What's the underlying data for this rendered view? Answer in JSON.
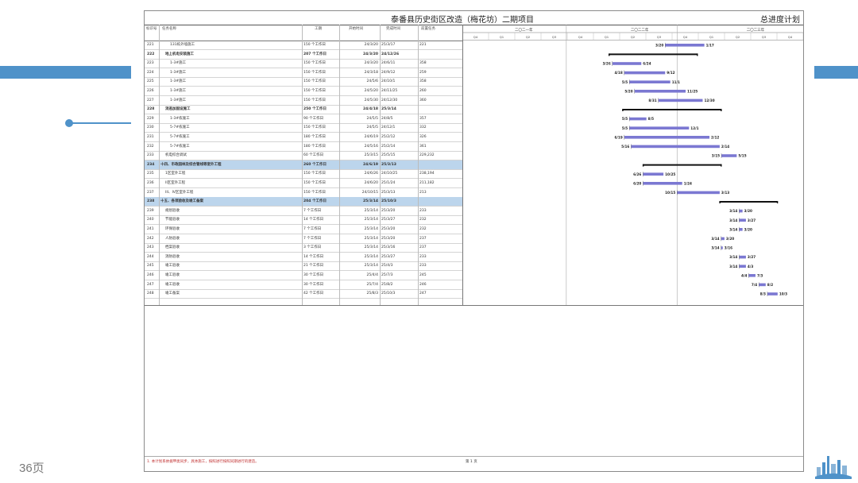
{
  "page_number": "36页",
  "colors": {
    "accent": "#4f92c9",
    "summary_row": "#bcd5ec",
    "task_bar": "#7b78d2",
    "summary_bar": "#111111",
    "note_text": "#c03030"
  },
  "sheet": {
    "title": "泰番县历史街区改造（梅花坊）二期项目",
    "plan_label": "总进度计划",
    "columns": [
      "标识号",
      "任务名称",
      "工期",
      "开始时间",
      "完成时间",
      "前置任务"
    ],
    "timeline_labels": [
      "二〇二一年",
      "二〇二二年",
      "二〇二三年"
    ],
    "quarter_labels": [
      "Q4",
      "Q1",
      "Q2",
      "Q3",
      "Q4",
      "Q1",
      "Q2",
      "Q3",
      "Q4",
      "Q1",
      "Q2",
      "Q3",
      "Q4"
    ],
    "footnote": "1. 本计划系依据甲类同步，具体施工，按照进行按照同期进行的建造。",
    "footer_page": "第 1 页"
  },
  "rows": [
    {
      "id": "221",
      "name": "131栋外墙施工",
      "dur": "150 个工作日",
      "start": "24/3/20",
      "end": "25/3/17",
      "pred": "221",
      "type": "task",
      "indent": 3
    },
    {
      "id": "222",
      "name": "地上机电安装施工",
      "dur": "207 个工作日",
      "start": "24/3/20",
      "end": "24/12/26",
      "pred": "",
      "type": "bold",
      "indent": 2
    },
    {
      "id": "223",
      "name": "1-3#施工",
      "dur": "150 个工作日",
      "start": "24/3/20",
      "end": "24/6/11",
      "pred": "358",
      "type": "task",
      "indent": 3
    },
    {
      "id": "224",
      "name": "1-3#施工",
      "dur": "150 个工作日",
      "start": "24/3/18",
      "end": "24/9/12",
      "pred": "259",
      "type": "task",
      "indent": 3
    },
    {
      "id": "225",
      "name": "1-3#施工",
      "dur": "150 个工作日",
      "start": "24/5/6",
      "end": "24/10/1",
      "pred": "358",
      "type": "task",
      "indent": 3
    },
    {
      "id": "226",
      "name": "1-3#施工",
      "dur": "150 个工作日",
      "start": "24/5/20",
      "end": "24/11/25",
      "pred": "260",
      "type": "task",
      "indent": 3
    },
    {
      "id": "227",
      "name": "1-3#施工",
      "dur": "150 个工作日",
      "start": "24/5/30",
      "end": "24/12/30",
      "pred": "360",
      "type": "task",
      "indent": 3
    },
    {
      "id": "228",
      "name": "消逃加固设施工",
      "dur": "250 个工作日",
      "start": "24/4/18",
      "end": "25/3/14",
      "pred": "",
      "type": "bold",
      "indent": 2
    },
    {
      "id": "229",
      "name": "1-3#栋施工",
      "dur": "90 个工作日",
      "start": "24/5/5",
      "end": "24/8/5",
      "pred": "357",
      "type": "task",
      "indent": 3
    },
    {
      "id": "230",
      "name": "5-7#栋施工",
      "dur": "150 个工作日",
      "start": "24/5/5",
      "end": "24/12/1",
      "pred": "332",
      "type": "task",
      "indent": 3
    },
    {
      "id": "231",
      "name": "5-7#栋施工",
      "dur": "180 个工作日",
      "start": "24/6/19",
      "end": "25/2/12",
      "pred": "326",
      "type": "task",
      "indent": 3
    },
    {
      "id": "232",
      "name": "5-7#栋施工",
      "dur": "180 个工作日",
      "start": "24/5/16",
      "end": "25/2/14",
      "pred": "361",
      "type": "task",
      "indent": 3
    },
    {
      "id": "233",
      "name": "机电综合调试",
      "dur": "60 个工作日",
      "start": "25/3/15",
      "end": "25/5/15",
      "pred": "229,232",
      "type": "task",
      "indent": 2
    },
    {
      "id": "234",
      "name": "十四、市政园林及综合管线等室外工程",
      "dur": "260 个工作日",
      "start": "24/6/19",
      "end": "25/3/13",
      "pred": "",
      "type": "sum",
      "indent": 1
    },
    {
      "id": "235",
      "name": "1区室外工程",
      "dur": "150 个工作日",
      "start": "24/6/26",
      "end": "24/10/25",
      "pred": "238,194",
      "type": "task",
      "indent": 2
    },
    {
      "id": "236",
      "name": "II区室外工程",
      "dur": "150 个工作日",
      "start": "24/6/20",
      "end": "25/1/24",
      "pred": "211,182",
      "type": "task",
      "indent": 2
    },
    {
      "id": "237",
      "name": "III、IV区室外工程",
      "dur": "150 个工作日",
      "start": "24/10/15",
      "end": "25/3/13",
      "pred": "213",
      "type": "task",
      "indent": 2
    },
    {
      "id": "238",
      "name": "十五、各项验收及竣工备案",
      "dur": "204 个工作日",
      "start": "25/3/14",
      "end": "25/10/3",
      "pred": "",
      "type": "sum",
      "indent": 1
    },
    {
      "id": "239",
      "name": "规划验收",
      "dur": "7 个工作日",
      "start": "25/3/14",
      "end": "25/3/20",
      "pred": "233",
      "type": "task",
      "indent": 2
    },
    {
      "id": "240",
      "name": "节能验收",
      "dur": "14 个工作日",
      "start": "25/3/14",
      "end": "25/3/27",
      "pred": "232",
      "type": "task",
      "indent": 2
    },
    {
      "id": "241",
      "name": "环保验收",
      "dur": "7 个工作日",
      "start": "25/3/14",
      "end": "25/3/20",
      "pred": "232",
      "type": "task",
      "indent": 2
    },
    {
      "id": "242",
      "name": "人防验收",
      "dur": "7 个工作日",
      "start": "25/3/14",
      "end": "25/3/20",
      "pred": "237",
      "type": "task",
      "indent": 2
    },
    {
      "id": "243",
      "name": "档案验收",
      "dur": "3 个工作日",
      "start": "25/3/14",
      "end": "25/3/16",
      "pred": "237",
      "type": "task",
      "indent": 2
    },
    {
      "id": "244",
      "name": "消防验收",
      "dur": "14 个工作日",
      "start": "25/3/14",
      "end": "25/3/27",
      "pred": "233",
      "type": "task",
      "indent": 2
    },
    {
      "id": "245",
      "name": "竣工验收",
      "dur": "21 个工作日",
      "start": "25/3/14",
      "end": "25/4/3",
      "pred": "233",
      "type": "task",
      "indent": 2
    },
    {
      "id": "246",
      "name": "竣工验收",
      "dur": "30 个工作日",
      "start": "25/4/4",
      "end": "25/7/3",
      "pred": "245",
      "type": "task",
      "indent": 2
    },
    {
      "id": "247",
      "name": "竣工验收",
      "dur": "30 个工作日",
      "start": "25/7/4",
      "end": "25/8/2",
      "pred": "246",
      "type": "task",
      "indent": 2
    },
    {
      "id": "248",
      "name": "竣工备案",
      "dur": "42 个工作日",
      "start": "25/8/3",
      "end": "25/10/3",
      "pred": "247",
      "type": "task",
      "indent": 2
    }
  ],
  "gantt_bars": [
    {
      "row": 0,
      "kind": "task",
      "s": 0.595,
      "e": 0.71,
      "ls": "3/20",
      "le": "1/17"
    },
    {
      "row": 1,
      "kind": "sum",
      "s": 0.43,
      "e": 0.69,
      "ls": "",
      "le": ""
    },
    {
      "row": 2,
      "kind": "task",
      "s": 0.44,
      "e": 0.525,
      "ls": "3/26",
      "le": "6/24"
    },
    {
      "row": 3,
      "kind": "task",
      "s": 0.475,
      "e": 0.595,
      "ls": "4/18",
      "le": "9/12"
    },
    {
      "row": 4,
      "kind": "task",
      "s": 0.49,
      "e": 0.61,
      "ls": "5/5",
      "le": "11/1"
    },
    {
      "row": 5,
      "kind": "task",
      "s": 0.505,
      "e": 0.655,
      "ls": "5/20",
      "le": "11/25"
    },
    {
      "row": 6,
      "kind": "task",
      "s": 0.575,
      "e": 0.705,
      "ls": "8/31",
      "le": "12/30"
    },
    {
      "row": 7,
      "kind": "sum",
      "s": 0.47,
      "e": 0.76,
      "ls": "",
      "le": ""
    },
    {
      "row": 8,
      "kind": "task",
      "s": 0.49,
      "e": 0.54,
      "ls": "5/5",
      "le": "8/5"
    },
    {
      "row": 9,
      "kind": "task",
      "s": 0.49,
      "e": 0.665,
      "ls": "5/5",
      "le": "12/1"
    },
    {
      "row": 10,
      "kind": "task",
      "s": 0.475,
      "e": 0.725,
      "ls": "6/19",
      "le": "2/12"
    },
    {
      "row": 11,
      "kind": "task",
      "s": 0.495,
      "e": 0.755,
      "ls": "5/16",
      "le": "2/14"
    },
    {
      "row": 12,
      "kind": "task",
      "s": 0.76,
      "e": 0.805,
      "ls": "3/15",
      "le": "5/15"
    },
    {
      "row": 13,
      "kind": "sum",
      "s": 0.53,
      "e": 0.76,
      "ls": "",
      "le": ""
    },
    {
      "row": 14,
      "kind": "task",
      "s": 0.53,
      "e": 0.59,
      "ls": "6/26",
      "le": "10/25"
    },
    {
      "row": 15,
      "kind": "task",
      "s": 0.53,
      "e": 0.645,
      "ls": "6/20",
      "le": "1/24"
    },
    {
      "row": 16,
      "kind": "task",
      "s": 0.63,
      "e": 0.755,
      "ls": "10/15",
      "le": "3/13"
    },
    {
      "row": 17,
      "kind": "sum",
      "s": 0.755,
      "e": 0.925,
      "ls": "",
      "le": ""
    },
    {
      "row": 18,
      "kind": "task",
      "s": 0.812,
      "e": 0.822,
      "ls": "3/14",
      "le": "3/20"
    },
    {
      "row": 19,
      "kind": "task",
      "s": 0.812,
      "e": 0.832,
      "ls": "3/14",
      "le": "3/27"
    },
    {
      "row": 20,
      "kind": "task",
      "s": 0.812,
      "e": 0.822,
      "ls": "3/14",
      "le": "3/20"
    },
    {
      "row": 21,
      "kind": "task",
      "s": 0.759,
      "e": 0.769,
      "ls": "3/14",
      "le": "3/20"
    },
    {
      "row": 22,
      "kind": "task",
      "s": 0.759,
      "e": 0.764,
      "ls": "3/14",
      "le": "3/16"
    },
    {
      "row": 23,
      "kind": "task",
      "s": 0.812,
      "e": 0.832,
      "ls": "3/14",
      "le": "3/27"
    },
    {
      "row": 24,
      "kind": "task",
      "s": 0.812,
      "e": 0.832,
      "ls": "3/14",
      "le": "4/3"
    },
    {
      "row": 25,
      "kind": "task",
      "s": 0.84,
      "e": 0.86,
      "ls": "4/4",
      "le": "7/3"
    },
    {
      "row": 26,
      "kind": "task",
      "s": 0.87,
      "e": 0.89,
      "ls": "7/4",
      "le": "8/2"
    },
    {
      "row": 27,
      "kind": "task",
      "s": 0.895,
      "e": 0.925,
      "ls": "8/3",
      "le": "10/3"
    }
  ]
}
